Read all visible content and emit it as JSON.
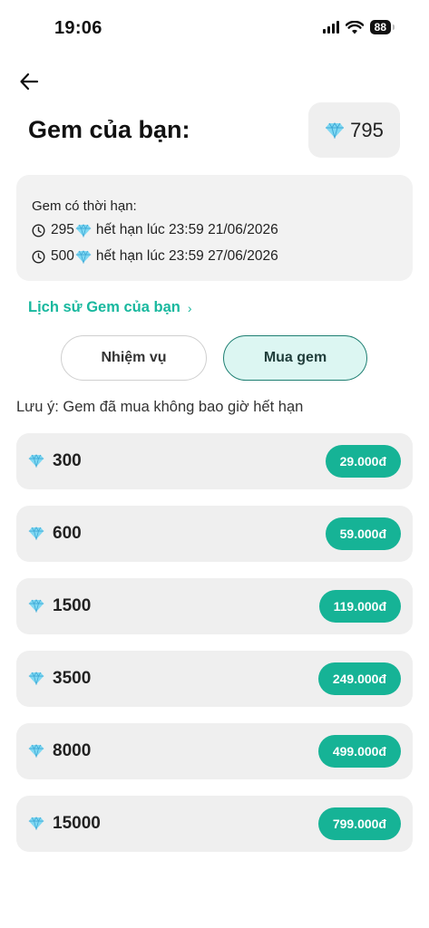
{
  "status_bar": {
    "time": "19:06",
    "battery": "88"
  },
  "header": {
    "title": "Gem của bạn:",
    "balance": "795"
  },
  "limited": {
    "title": "Gem có thời hạn:",
    "items": [
      {
        "amount": "295",
        "expiry": "hết hạn lúc 23:59 21/06/2026"
      },
      {
        "amount": "500",
        "expiry": "hết hạn lúc 23:59 27/06/2026"
      }
    ]
  },
  "history_link": {
    "label": "Lịch sử Gem của bạn",
    "chevron": "›"
  },
  "tabs": [
    {
      "label": "Nhiệm vụ",
      "active": false
    },
    {
      "label": "Mua gem",
      "active": true
    }
  ],
  "note": "Lưu ý: Gem đã mua không bao giờ hết hạn",
  "packages": [
    {
      "amount": "300",
      "price": "29.000đ"
    },
    {
      "amount": "600",
      "price": "59.000đ"
    },
    {
      "amount": "1500",
      "price": "119.000đ"
    },
    {
      "amount": "3500",
      "price": "249.000đ"
    },
    {
      "amount": "8000",
      "price": "499.000đ"
    },
    {
      "amount": "15000",
      "price": "799.000đ"
    }
  ],
  "icons": {
    "gem": "gem-icon",
    "clock": "clock-icon",
    "back": "back-arrow-icon"
  },
  "colors": {
    "accent": "#18b89e",
    "price_button": "#16b396",
    "active_tab_bg": "#dcf6f2",
    "active_tab_border": "#1e7f72"
  }
}
